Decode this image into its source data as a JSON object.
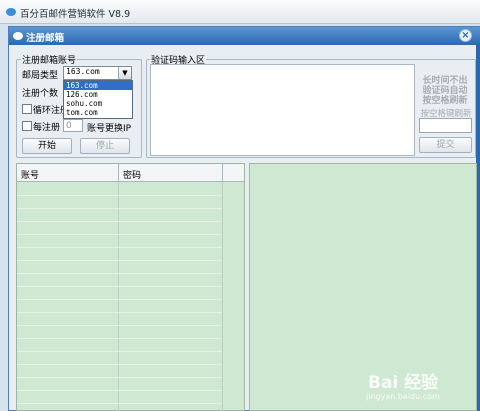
{
  "app": {
    "title": "百分百邮件营销软件   V8.9"
  },
  "dialog": {
    "title": "注册邮箱",
    "close_glyph": "×"
  },
  "register_group": {
    "legend": "注册邮箱账号",
    "mail_type_label": "邮局类型",
    "selected_domain": "163.com",
    "dropdown_options": [
      "163.com",
      "126.com",
      "sohu.com",
      "tom.com"
    ],
    "count_label": "注册个数",
    "loop_label": "循环注册",
    "each_label": "每注册",
    "each_value": "0",
    "change_ip_label": "账号更换IP",
    "start_button": "开始",
    "stop_button": "停止"
  },
  "captcha_group": {
    "legend": "验证码输入区",
    "hint": "长时间不出验证码自动按空格刷新",
    "refresh_hint": "按空格键刷新",
    "submit_button": "提交"
  },
  "table": {
    "columns": [
      "账号",
      "密码"
    ]
  },
  "watermark": {
    "text": "Bai 经验",
    "sub": "jingyan.baidu.com"
  }
}
